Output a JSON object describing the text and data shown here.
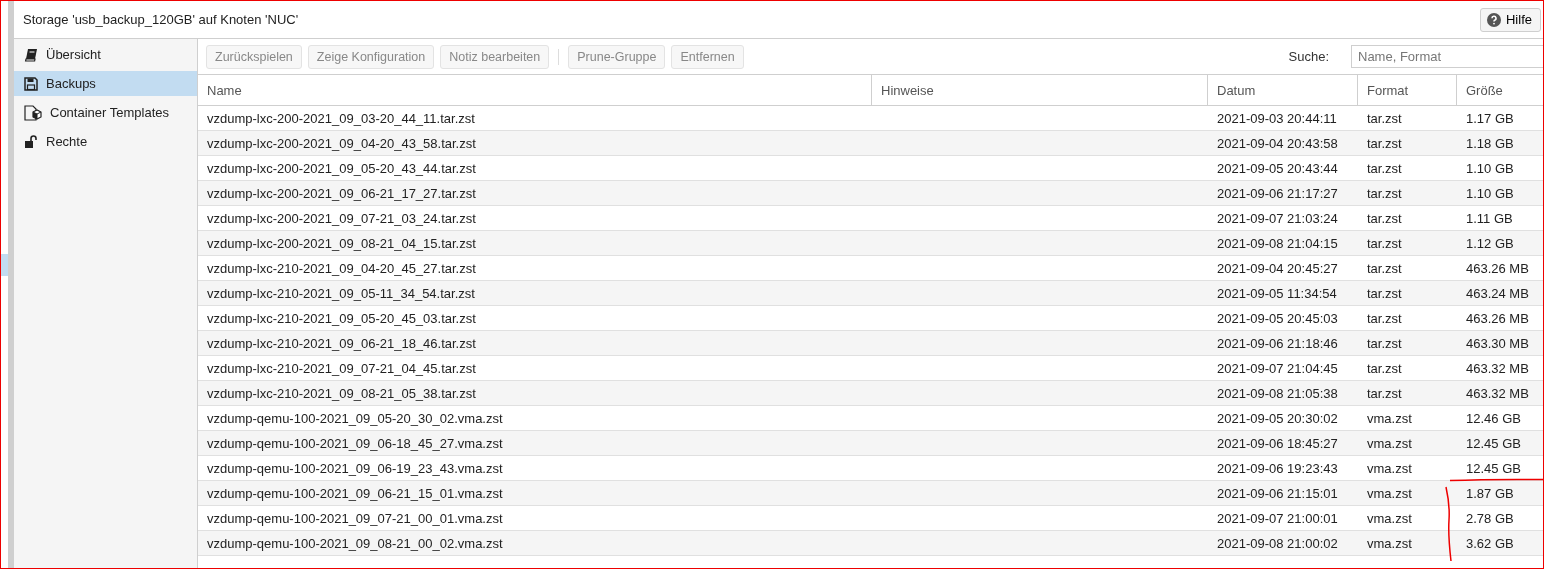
{
  "panel": {
    "title": "Storage 'usb_backup_120GB' auf Knoten 'NUC'",
    "help_button": "Hilfe"
  },
  "sidebar": {
    "items": [
      {
        "label": "Übersicht",
        "selected": false
      },
      {
        "label": "Backups",
        "selected": true
      },
      {
        "label": "Container Templates",
        "selected": false
      },
      {
        "label": "Rechte",
        "selected": false
      }
    ]
  },
  "toolbar": {
    "buttons": [
      {
        "label": "Zurückspielen",
        "disabled": true
      },
      {
        "label": "Zeige Konfiguration",
        "disabled": true
      },
      {
        "label": "Notiz bearbeiten",
        "disabled": true
      },
      {
        "label": "Prune-Gruppe",
        "disabled": true,
        "separator_before": true
      },
      {
        "label": "Entfernen",
        "disabled": true
      }
    ],
    "search_label": "Suche:",
    "search": {
      "placeholder": "Name, Format"
    }
  },
  "table": {
    "columns": [
      "Name",
      "Hinweise",
      "Datum",
      "Format",
      "Größe"
    ],
    "rows": [
      [
        "vzdump-lxc-200-2021_09_03-20_44_11.tar.zst",
        "",
        "2021-09-03 20:44:11",
        "tar.zst",
        "1.17 GB"
      ],
      [
        "vzdump-lxc-200-2021_09_04-20_43_58.tar.zst",
        "",
        "2021-09-04 20:43:58",
        "tar.zst",
        "1.18 GB"
      ],
      [
        "vzdump-lxc-200-2021_09_05-20_43_44.tar.zst",
        "",
        "2021-09-05 20:43:44",
        "tar.zst",
        "1.10 GB"
      ],
      [
        "vzdump-lxc-200-2021_09_06-21_17_27.tar.zst",
        "",
        "2021-09-06 21:17:27",
        "tar.zst",
        "1.10 GB"
      ],
      [
        "vzdump-lxc-200-2021_09_07-21_03_24.tar.zst",
        "",
        "2021-09-07 21:03:24",
        "tar.zst",
        "1.11 GB"
      ],
      [
        "vzdump-lxc-200-2021_09_08-21_04_15.tar.zst",
        "",
        "2021-09-08 21:04:15",
        "tar.zst",
        "1.12 GB"
      ],
      [
        "vzdump-lxc-210-2021_09_04-20_45_27.tar.zst",
        "",
        "2021-09-04 20:45:27",
        "tar.zst",
        "463.26 MB"
      ],
      [
        "vzdump-lxc-210-2021_09_05-11_34_54.tar.zst",
        "",
        "2021-09-05 11:34:54",
        "tar.zst",
        "463.24 MB"
      ],
      [
        "vzdump-lxc-210-2021_09_05-20_45_03.tar.zst",
        "",
        "2021-09-05 20:45:03",
        "tar.zst",
        "463.26 MB"
      ],
      [
        "vzdump-lxc-210-2021_09_06-21_18_46.tar.zst",
        "",
        "2021-09-06 21:18:46",
        "tar.zst",
        "463.30 MB"
      ],
      [
        "vzdump-lxc-210-2021_09_07-21_04_45.tar.zst",
        "",
        "2021-09-07 21:04:45",
        "tar.zst",
        "463.32 MB"
      ],
      [
        "vzdump-lxc-210-2021_09_08-21_05_38.tar.zst",
        "",
        "2021-09-08 21:05:38",
        "tar.zst",
        "463.32 MB"
      ],
      [
        "vzdump-qemu-100-2021_09_05-20_30_02.vma.zst",
        "",
        "2021-09-05 20:30:02",
        "vma.zst",
        "12.46 GB"
      ],
      [
        "vzdump-qemu-100-2021_09_06-18_45_27.vma.zst",
        "",
        "2021-09-06 18:45:27",
        "vma.zst",
        "12.45 GB"
      ],
      [
        "vzdump-qemu-100-2021_09_06-19_23_43.vma.zst",
        "",
        "2021-09-06 19:23:43",
        "vma.zst",
        "12.45 GB"
      ],
      [
        "vzdump-qemu-100-2021_09_06-21_15_01.vma.zst",
        "",
        "2021-09-06 21:15:01",
        "vma.zst",
        "1.87 GB"
      ],
      [
        "vzdump-qemu-100-2021_09_07-21_00_01.vma.zst",
        "",
        "2021-09-07 21:00:01",
        "vma.zst",
        "2.78 GB"
      ],
      [
        "vzdump-qemu-100-2021_09_08-21_00_02.vma.zst",
        "",
        "2021-09-08 21:00:02",
        "vma.zst",
        "3.62 GB"
      ]
    ]
  }
}
